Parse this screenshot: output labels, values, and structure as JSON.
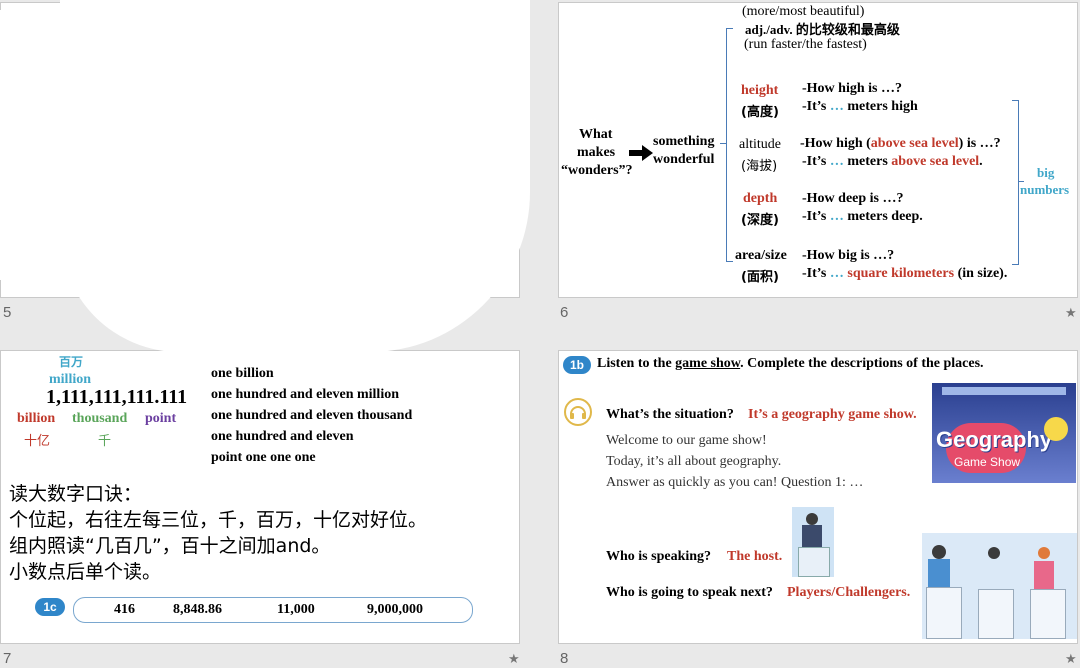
{
  "slide_numbers": {
    "s5": "5",
    "s6": "6",
    "s7": "7",
    "s8": "8"
  },
  "star": "★",
  "s6": {
    "top_1": "(more/most beautiful)",
    "top_2": "adj./adv. 的比较级和最高级",
    "top_3": "(run faster/the fastest)",
    "what_makes": "What",
    "what_makes_2": "makes",
    "what_makes_3": "“wonders”?",
    "something": "something",
    "wonderful": "wonderful",
    "height": "height",
    "height_cn": "(高度)",
    "height_q": "-How high is …?",
    "height_a_1": "-It’s",
    "height_a_dots": " …",
    "height_a_2": " meters high",
    "altitude": "altitude",
    "altitude_cn": "(海拔)",
    "altitude_q_1": "-How high (",
    "altitude_q_red": "above sea level",
    "altitude_q_2": ") is …?",
    "altitude_a_1": "-It’s",
    "altitude_a_dots": " …",
    "altitude_a_2": " meters ",
    "altitude_a_red": "above sea level",
    "altitude_a_3": ".",
    "depth": "depth",
    "depth_cn": "(深度)",
    "depth_q": "-How deep is …?",
    "depth_a_1": "-It’s",
    "depth_a_dots": " …",
    "depth_a_2": " meters deep.",
    "area": "area/size",
    "area_cn": "(面积)",
    "area_q": "-How big is …?",
    "area_a_1": "-It’s",
    "area_a_dots": " …",
    "area_a_red": " square kilometers",
    "area_a_2": " (in size).",
    "big": "big",
    "numbers": "numbers"
  },
  "s7": {
    "baiwan": "百万",
    "million": "million",
    "big_number": "1,111,111,111.111",
    "billion": "billion",
    "thousand": "thousand",
    "point": "point",
    "shiyi": "十亿",
    "qian": "千",
    "read_lines": [
      "one billion",
      "one hundred and eleven million",
      "one hundred and eleven thousand",
      "one hundred and eleven",
      "point one one one"
    ],
    "rule_title": "读大数字口诀：",
    "rule_1": "个位起，右往左每三位，千，百万，十亿对好位。",
    "rule_2": "组内照读“几百几”，百十之间加and。",
    "rule_3": "小数点后单个读。",
    "badge": "1c",
    "numbers": [
      "416",
      "8,848.86",
      "11,000",
      "9,000,000"
    ]
  },
  "s8": {
    "badge": "1b",
    "instr_1": "Listen to the ",
    "instr_u": "game show",
    "instr_2": ". Complete the descriptions of the places.",
    "q1": "What’s the situation?",
    "a1": "It’s a geography game show.",
    "p1": "Welcome to our game show!",
    "p2": "Today, it’s all about geography.",
    "p3": "Answer as quickly as you can! Question 1: …",
    "q2": "Who is speaking?",
    "a2": "The host.",
    "q3": "Who is going to speak next?",
    "a3": "Players/Challengers.",
    "logo_1": "Geography",
    "logo_2": "Game Show"
  }
}
